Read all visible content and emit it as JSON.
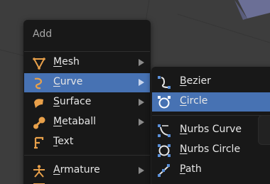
{
  "add_menu": {
    "title": "Add",
    "items": [
      {
        "underline": "M",
        "rest": "esh",
        "icon": "mesh-icon",
        "has_submenu": true,
        "active": false
      },
      {
        "underline": "C",
        "rest": "urve",
        "icon": "curve-icon",
        "has_submenu": true,
        "active": true
      },
      {
        "underline": "S",
        "rest": "urface",
        "icon": "surface-icon",
        "has_submenu": true,
        "active": false
      },
      {
        "underline": "M",
        "rest": "etaball",
        "icon": "metaball-icon",
        "has_submenu": true,
        "active": false
      },
      {
        "underline": "T",
        "rest": "ext",
        "icon": "text-icon",
        "has_submenu": false,
        "active": false
      },
      {
        "underline": "A",
        "rest": "rmature",
        "icon": "armature-icon",
        "has_submenu": true,
        "active": false
      }
    ]
  },
  "curve_submenu": {
    "items": [
      {
        "underline": "B",
        "rest": "ezier",
        "icon": "bezier-curve-icon",
        "active": false
      },
      {
        "underline": "C",
        "rest": "ircle",
        "icon": "bezier-circle-icon",
        "active": true
      },
      {
        "underline": "N",
        "rest": "urbs Curve",
        "icon": "nurbs-curve-icon",
        "active": false
      },
      {
        "underline": "N",
        "rest": "urbs Circle",
        "icon": "nurbs-circle-icon",
        "active": false
      },
      {
        "underline": "P",
        "rest": "ath",
        "icon": "path-icon",
        "active": false
      }
    ]
  },
  "colors": {
    "menu_bg": "#181818",
    "highlight": "#4772b3",
    "text": "#e6e6e6",
    "icon_orange": "#e8a04a",
    "icon_blue": "#5a8fd8"
  }
}
